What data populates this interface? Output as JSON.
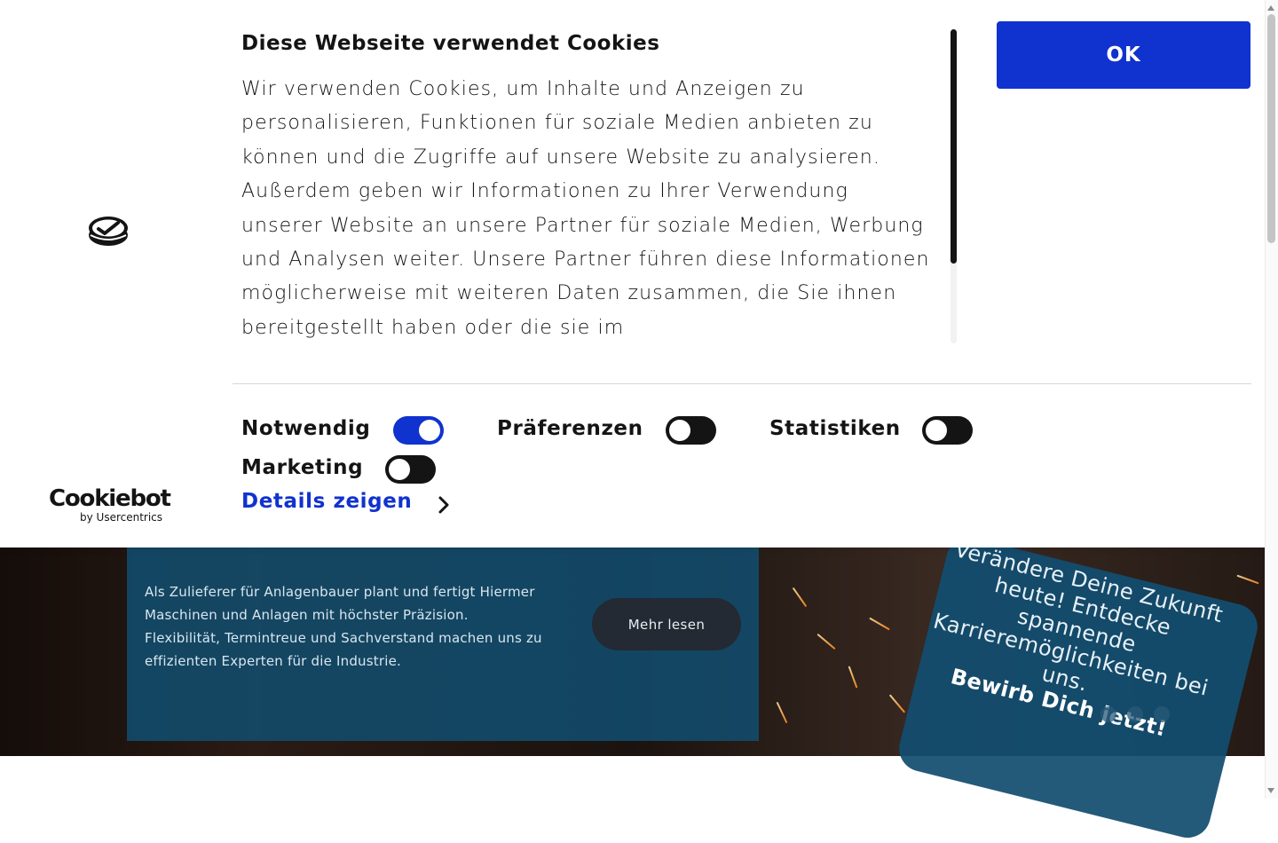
{
  "cookie_banner": {
    "brand_name": "Cookiebot",
    "brand_sub": "by Usercentrics",
    "title": "Diese Webseite verwendet Cookies",
    "body": "Wir verwenden Cookies, um Inhalte und Anzeigen zu personalisieren, Funktionen für soziale Medien anbieten zu können und die Zugriffe auf unsere Website zu analysieren. Außerdem geben wir Informationen zu Ihrer Verwendung unserer Website an unsere Partner für soziale Medien, Werbung und Analysen weiter. Unsere Partner führen diese Informationen möglicherweise mit weiteren Daten zusammen, die Sie ihnen bereitgestellt haben oder die sie im",
    "ok_label": "OK",
    "ok_color": "#1032cf",
    "toggles": [
      {
        "label": "Notwendig",
        "enabled": true
      },
      {
        "label": "Präferenzen",
        "enabled": false
      },
      {
        "label": "Statistiken",
        "enabled": false
      },
      {
        "label": "Marketing",
        "enabled": false
      }
    ],
    "details_label": "Details zeigen"
  },
  "hero": {
    "paragraph_1": "Als Zulieferer für Anlagenbauer plant und fertigt Hiermer Maschinen und Anlagen mit höchster Präzision.",
    "paragraph_2": "Flexibilität, Termintreue und Sachverstand machen uns zu effizienten Experten für die Industrie.",
    "more_label": "Mehr lesen",
    "career_text": "Verändere Deine Zukunft heute! Entdecke spannende Karrieremöglichkeiten bei uns.",
    "career_cta": "Bewirb Dich jetzt!"
  }
}
